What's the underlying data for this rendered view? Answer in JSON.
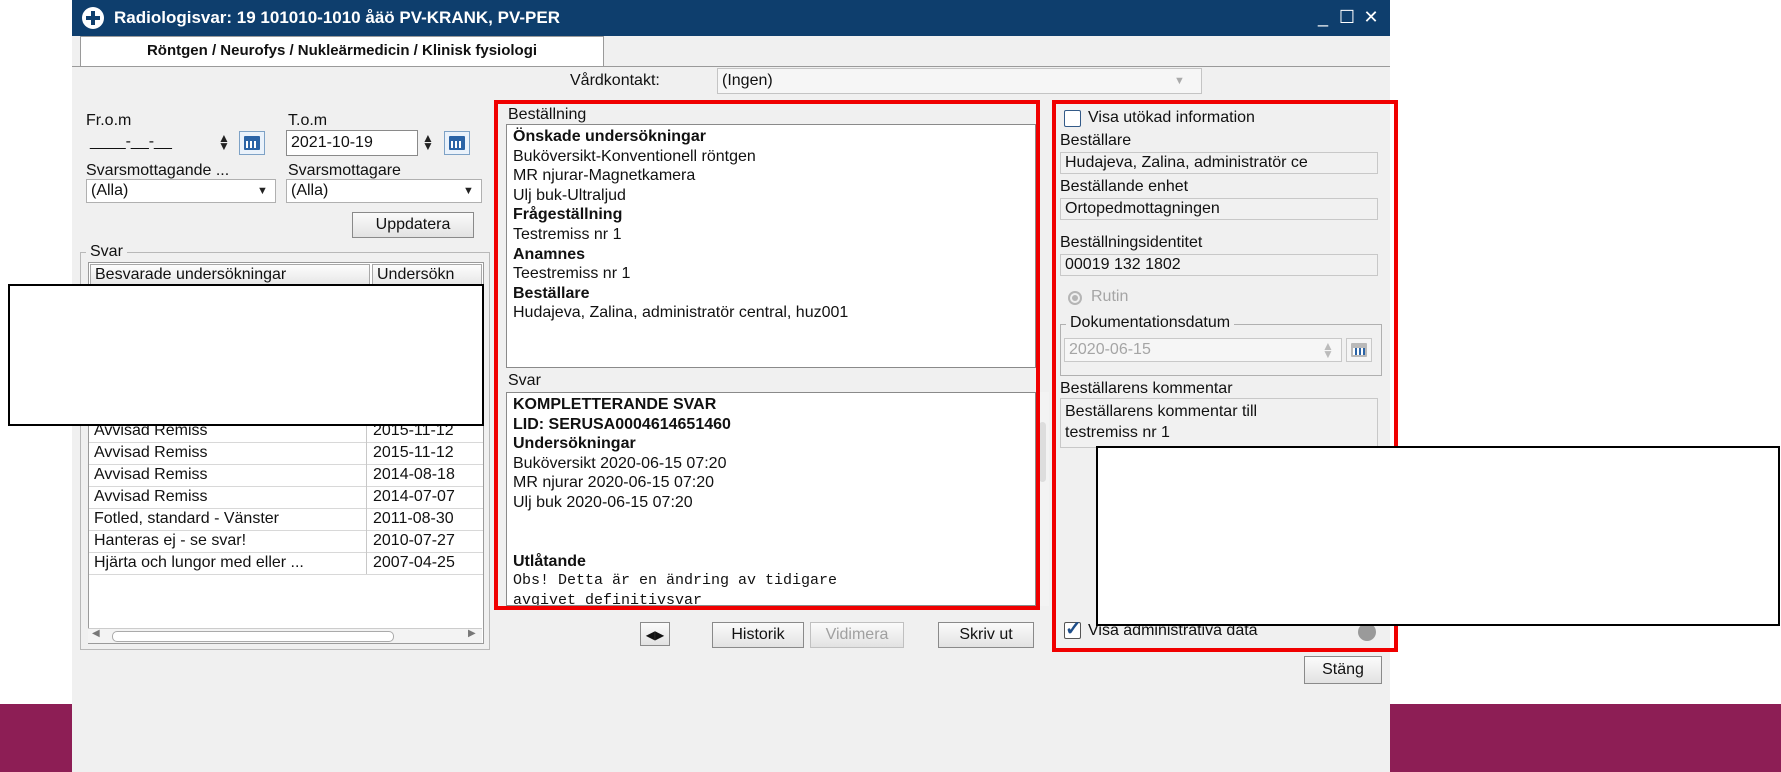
{
  "window": {
    "title": "Radiologisvar: 19 101010-1010 åäö PV-KRANK, PV-PER",
    "minimize_glyph": "_",
    "maximize_glyph": "☐",
    "close_glyph": "✕"
  },
  "tab": {
    "label": "Röntgen / Neurofys / Nukleärmedicin / Klinisk fysiologi"
  },
  "vardkontakt": {
    "label": "Vårdkontakt:",
    "value": "(Ingen)"
  },
  "filters": {
    "from_label": "Fr.o.m",
    "from_value": "____-__-__",
    "to_label": "T.o.m",
    "to_value": "2021-10-19",
    "receiving_unit_label": "Svarsmottagande ...",
    "receiving_unit_value": "(Alla)",
    "receiver_label": "Svarsmottagare",
    "receiver_value": "(Alla)",
    "update_button": "Uppdatera"
  },
  "svar_list": {
    "group_label": "Svar",
    "columns": [
      "Besvarade undersökningar",
      "Undersökn"
    ],
    "rows": [
      {
        "name": "Avvisad Remiss",
        "date": "2015-11-12"
      },
      {
        "name": "Avvisad Remiss",
        "date": "2015-11-12"
      },
      {
        "name": "Avvisad Remiss",
        "date": "2014-08-18"
      },
      {
        "name": "Avvisad Remiss",
        "date": "2014-07-07"
      },
      {
        "name": "Fotled, standard - Vänster",
        "date": "2011-08-30"
      },
      {
        "name": "Hanteras ej - se svar!",
        "date": "2010-07-27"
      },
      {
        "name": "Hjärta och lungor  med eller ...",
        "date": "2007-04-25"
      }
    ]
  },
  "bestallning": {
    "label": "Beställning",
    "lines": [
      {
        "text": "Önskade undersökningar",
        "bold": true
      },
      {
        "text": "Buköversikt-Konventionell röntgen",
        "bold": false
      },
      {
        "text": "MR njurar-Magnetkamera",
        "bold": false
      },
      {
        "text": "Ulj buk-Ultraljud",
        "bold": false
      },
      {
        "text": "Frågeställning",
        "bold": true
      },
      {
        "text": "Testremiss nr 1",
        "bold": false
      },
      {
        "text": "Anamnes",
        "bold": true
      },
      {
        "text": "Teestremiss nr 1",
        "bold": false
      },
      {
        "text": "Beställare",
        "bold": true
      },
      {
        "text": "Hudajeva, Zalina, administratör central, huz001",
        "bold": false
      }
    ]
  },
  "svar": {
    "label": "Svar",
    "lines": [
      {
        "text": "KOMPLETTERANDE SVAR",
        "bold": true,
        "mono": false
      },
      {
        "text": "LID: SERUSA0004614651460",
        "bold": true,
        "mono": false
      },
      {
        "text": "Undersökningar",
        "bold": true,
        "mono": false
      },
      {
        "text": "Buköversikt 2020-06-15 07:20",
        "bold": false,
        "mono": false
      },
      {
        "text": "MR njurar 2020-06-15 07:20",
        "bold": false,
        "mono": false
      },
      {
        "text": "Ulj buk 2020-06-15 07:20",
        "bold": false,
        "mono": false
      },
      {
        "text": "",
        "bold": false,
        "mono": false
      },
      {
        "text": "",
        "bold": false,
        "mono": false
      },
      {
        "text": "Utlåtande",
        "bold": true,
        "mono": false
      },
      {
        "text": "Obs! Detta är en ändring av tidigare",
        "bold": false,
        "mono": true
      },
      {
        "text": "avgivet definitivsvar",
        "bold": false,
        "mono": true
      }
    ]
  },
  "toolbar": {
    "nav_glyph": "◀▶",
    "history": "Historik",
    "sign": "Vidimera",
    "print": "Skriv ut",
    "close": "Stäng"
  },
  "details": {
    "show_extended": "Visa utökad information",
    "orderer_label": "Beställare",
    "orderer_value": "Hudajeva, Zalina, administratör ce",
    "unit_label": "Beställande enhet",
    "unit_value": "Ortopedmottagningen",
    "order_id_label": "Beställningsidentitet",
    "order_id_value": "00019 132 1802",
    "priority": "Rutin",
    "doc_date_label": "Dokumentationsdatum",
    "doc_date_value": "2020-06-15",
    "comment_label": "Beställarens kommentar",
    "comment_lines": [
      "Beställarens kommentar till",
      "testremiss nr 1"
    ],
    "show_admin": "Visa administrativa data"
  },
  "colors": {
    "title_bar": "#0e3e6d",
    "highlight": "#f00000",
    "bottom_band": "#8d1e55"
  }
}
